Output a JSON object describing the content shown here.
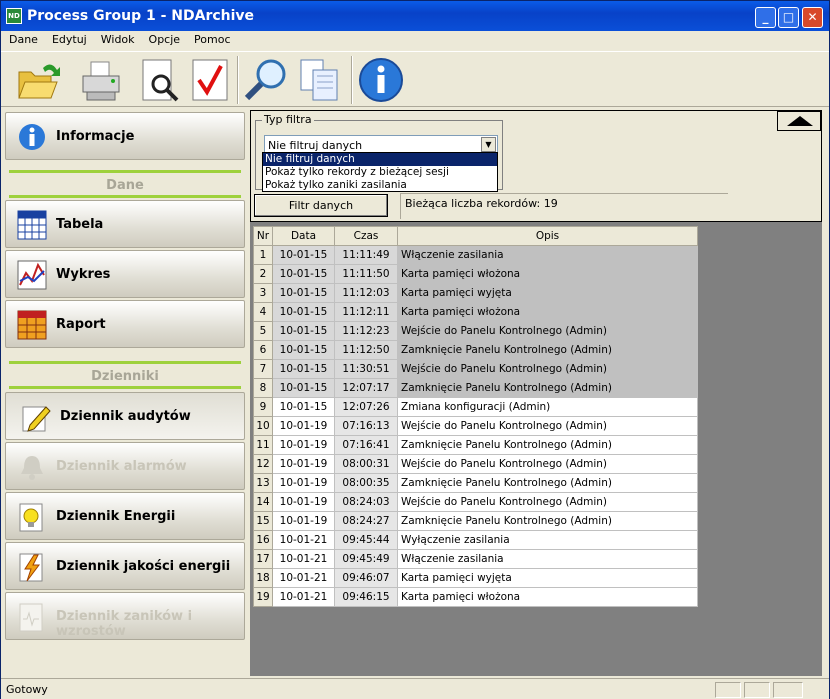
{
  "window": {
    "title": "Process Group 1 - NDArchive",
    "app_icon_text": "ND"
  },
  "menu": [
    "Dane",
    "Edytuj",
    "Widok",
    "Opcje",
    "Pomoc"
  ],
  "toolbar": {
    "icons": [
      "open-folder-icon",
      "print-icon",
      "print-preview-icon",
      "check-icon",
      "search-icon",
      "copy-icon",
      "info-icon"
    ]
  },
  "sidebar": {
    "info_label": "Informacje",
    "section_data": "Dane",
    "table_label": "Tabela",
    "chart_label": "Wykres",
    "report_label": "Raport",
    "section_logs": "Dzienniki",
    "audit_label": "Dziennik audytów",
    "alarm_label": "Dziennik alarmów",
    "energy_label": "Dziennik Energii",
    "quality_label": "Dziennik jakości energii",
    "outage_label": "Dziennik zaników i wzrostów"
  },
  "filter": {
    "group_label": "Typ filtra",
    "selected": "Nie filtruj danych",
    "options": [
      "Nie filtruj danych",
      "Pokaż tylko rekordy z bieżącej sesji",
      "Pokaż tylko zaniki zasilania"
    ],
    "button_label": "Filtr danych",
    "record_count": "Bieżąca liczba rekordów: 19"
  },
  "table": {
    "headers": [
      "Nr",
      "Data",
      "Czas",
      "Opis"
    ],
    "rows": [
      [
        "1",
        "10-01-15",
        "11:11:49",
        "Włączenie zasilania"
      ],
      [
        "2",
        "10-01-15",
        "11:11:50",
        "Karta pamięci włożona"
      ],
      [
        "3",
        "10-01-15",
        "11:12:03",
        "Karta pamięci wyjęta"
      ],
      [
        "4",
        "10-01-15",
        "11:12:11",
        "Karta pamięci włożona"
      ],
      [
        "5",
        "10-01-15",
        "11:12:23",
        "Wejście do Panelu Kontrolnego (Admin)"
      ],
      [
        "6",
        "10-01-15",
        "11:12:50",
        "Zamknięcie Panelu Kontrolnego (Admin)"
      ],
      [
        "7",
        "10-01-15",
        "11:30:51",
        "Wejście do Panelu Kontrolnego (Admin)"
      ],
      [
        "8",
        "10-01-15",
        "12:07:17",
        "Zamknięcie Panelu Kontrolnego (Admin)"
      ],
      [
        "9",
        "10-01-15",
        "12:07:26",
        "Zmiana konfiguracji (Admin)"
      ],
      [
        "10",
        "10-01-19",
        "07:16:13",
        "Wejście do Panelu Kontrolnego (Admin)"
      ],
      [
        "11",
        "10-01-19",
        "07:16:41",
        "Zamknięcie Panelu Kontrolnego (Admin)"
      ],
      [
        "12",
        "10-01-19",
        "08:00:31",
        "Wejście do Panelu Kontrolnego (Admin)"
      ],
      [
        "13",
        "10-01-19",
        "08:00:35",
        "Zamknięcie Panelu Kontrolnego (Admin)"
      ],
      [
        "14",
        "10-01-19",
        "08:24:03",
        "Wejście do Panelu Kontrolnego (Admin)"
      ],
      [
        "15",
        "10-01-19",
        "08:24:27",
        "Zamknięcie Panelu Kontrolnego (Admin)"
      ],
      [
        "16",
        "10-01-21",
        "09:45:44",
        "Wyłączenie zasilania"
      ],
      [
        "17",
        "10-01-21",
        "09:45:49",
        "Włączenie zasilania"
      ],
      [
        "18",
        "10-01-21",
        "09:46:07",
        "Karta pamięci wyjęta"
      ],
      [
        "19",
        "10-01-21",
        "09:46:15",
        "Karta pamięci włożona"
      ]
    ],
    "highlighted_rows": 8
  },
  "status": {
    "text": "Gotowy"
  }
}
